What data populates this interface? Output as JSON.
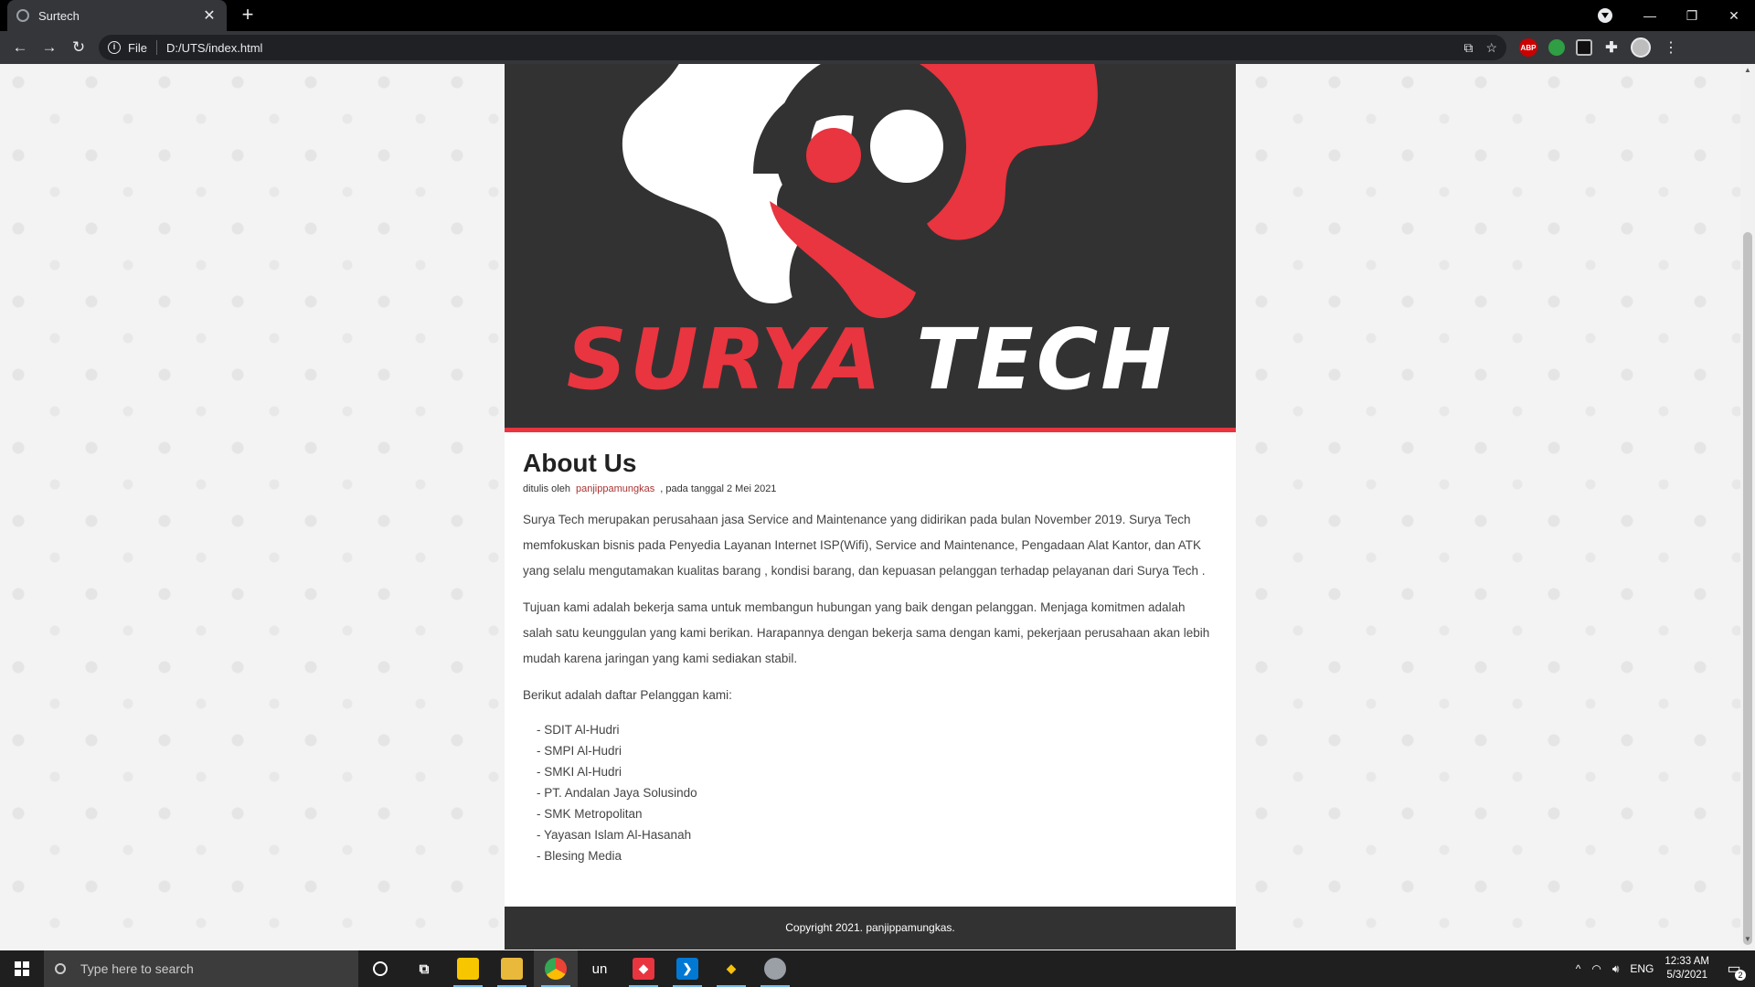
{
  "browser": {
    "tab_title": "Surtech",
    "tab_close": "✕",
    "new_tab": "+",
    "scheme_label": "File",
    "address": "D:/UTS/index.html",
    "extensions": {
      "abp": "ABP"
    },
    "window_controls": {
      "minimize": "—",
      "restore": "❐",
      "close": "✕"
    }
  },
  "site": {
    "brand_part1": "SURYA",
    "brand_part2": "TECH",
    "accent_color": "#e8353f",
    "header_bg": "#323233"
  },
  "article": {
    "title": "About Us",
    "meta_prefix": "ditulis oleh",
    "author": "panjippamungkas",
    "meta_suffix": ", pada tanggal 2 Mei 2021",
    "paragraph1": "Surya Tech merupakan perusahaan jasa Service and Maintenance yang didirikan pada bulan November 2019. Surya Tech memfokuskan bisnis pada Penyedia Layanan Internet ISP(Wifi), Service and Maintenance, Pengadaan Alat Kantor, dan ATK yang selalu mengutamakan kualitas barang , kondisi barang, dan kepuasan pelanggan terhadap pelayanan dari Surya Tech .",
    "paragraph2": "Tujuan kami adalah bekerja sama untuk membangun hubungan yang baik dengan pelanggan. Menjaga komitmen adalah salah satu keunggulan yang kami berikan. Harapannya dengan bekerja sama dengan kami, pekerjaan perusahaan akan lebih mudah karena jaringan yang kami sediakan stabil.",
    "paragraph3": "Berikut adalah daftar Pelanggan kami:",
    "clients": [
      "- SDIT Al-Hudri",
      "- SMPI Al-Hudri",
      "- SMKI Al-Hudri",
      "- PT. Andalan Jaya Solusindo",
      "- SMK Metropolitan",
      "- Yayasan Islam Al-Hasanah",
      "- Blesing Media"
    ]
  },
  "footer": {
    "copyright": "Copyright 2021. panjippamungkas."
  },
  "taskbar": {
    "search_placeholder": "Type here to search",
    "apps": [
      "cortana",
      "task-view",
      "sticky-notes",
      "file-explorer",
      "chrome",
      "un",
      "git-client",
      "vscode",
      "git",
      "other-app"
    ],
    "app_un_label": "un",
    "language": "ENG",
    "time": "12:33 AM",
    "date": "5/3/2021",
    "notification_count": "2"
  }
}
